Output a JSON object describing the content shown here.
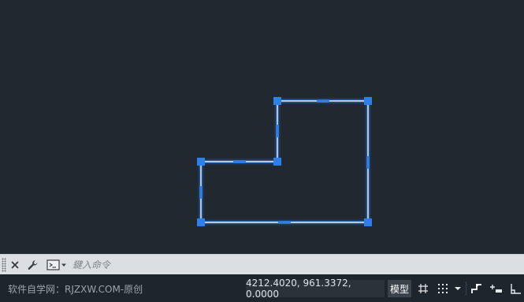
{
  "canvas": {
    "background": "#212830",
    "selection_color": "#2f7fe8",
    "line_color": "#e8eef8"
  },
  "command_line": {
    "placeholder": "鍵入命令",
    "close_icon": "close-icon",
    "customize_icon": "wrench-icon",
    "prompt_icon": "command-prompt-icon"
  },
  "status_bar": {
    "watermark": "软件自学网：RJZXW.COM-原创",
    "coordinates": "4212.4020, 961.3372, 0.0000",
    "model_label": "模型",
    "icons": [
      "grid-icon",
      "snap-grid-icon",
      "dropdown-arrow-icon",
      "infer-constraints-icon",
      "dynamic-input-icon",
      "ortho-icon"
    ]
  }
}
